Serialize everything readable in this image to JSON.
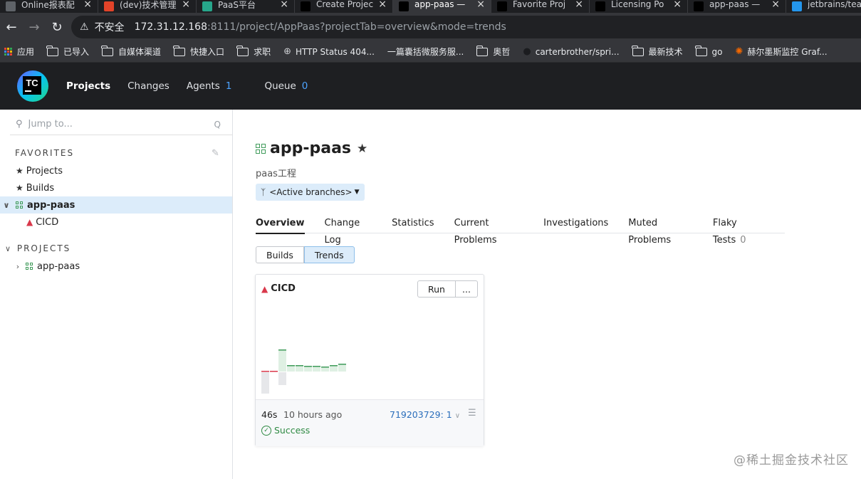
{
  "browser": {
    "tabs": [
      {
        "label": "Online报表配",
        "favicon": "globe-icon",
        "color": "#5f6368",
        "active": false
      },
      {
        "label": "(dev)技术管理",
        "favicon": "gitlab-icon",
        "color": "#e24329",
        "active": false
      },
      {
        "label": "PaaS平台",
        "favicon": "paas-icon",
        "color": "#27a68b",
        "active": false
      },
      {
        "label": "Create Projec",
        "favicon": "teamcity-icon",
        "color": "#000000",
        "active": false
      },
      {
        "label": "app-paas —",
        "favicon": "teamcity-icon",
        "color": "#000000",
        "active": true
      },
      {
        "label": "Favorite Proj",
        "favicon": "teamcity-icon",
        "color": "#000000",
        "active": false
      },
      {
        "label": "Licensing Po",
        "favicon": "jetbrains-icon",
        "color": "#000000",
        "active": false
      },
      {
        "label": "app-paas —",
        "favicon": "teamcity-icon",
        "color": "#000000",
        "active": false
      },
      {
        "label": "jetbrains/tea",
        "favicon": "docker-icon",
        "color": "#2496ed",
        "active": false
      }
    ],
    "insecure_label": "不安全",
    "url_host": "172.31.12.168",
    "url_rest": ":8111/project/AppPaas?projectTab=overview&mode=trends",
    "bookmarks": [
      {
        "label": "应用",
        "icon": "apps-grid-icon"
      },
      {
        "label": "已导入",
        "icon": "folder-icon"
      },
      {
        "label": "自媒体渠道",
        "icon": "folder-icon"
      },
      {
        "label": "快捷入口",
        "icon": "folder-icon"
      },
      {
        "label": "求职",
        "icon": "folder-icon"
      },
      {
        "label": "HTTP Status 404...",
        "icon": "globe-icon"
      },
      {
        "label": "一篇囊括微服务服...",
        "icon": "none"
      },
      {
        "label": "奥哲",
        "icon": "folder-icon"
      },
      {
        "label": "carterbrother/spri...",
        "icon": "github-icon"
      },
      {
        "label": "最新技术",
        "icon": "folder-icon"
      },
      {
        "label": "go",
        "icon": "folder-icon"
      },
      {
        "label": "赫尔墨斯监控 Graf...",
        "icon": "grafana-icon"
      }
    ]
  },
  "header": {
    "logo_text": "TC",
    "nav": {
      "projects": "Projects",
      "changes": "Changes",
      "agents": "Agents",
      "agents_count": "1",
      "queue": "Queue",
      "queue_count": "0"
    }
  },
  "sidebar": {
    "search_placeholder": "Jump to...",
    "search_shortcut": "Q",
    "favorites_title": "FAVORITES",
    "favorites": [
      {
        "label": "Projects"
      },
      {
        "label": "Builds"
      }
    ],
    "fav_project": "app-paas",
    "fav_build": "CICD",
    "projects_title": "PROJECTS",
    "project": "app-paas"
  },
  "main": {
    "title": "app-paas",
    "description": "paas工程",
    "branch_filter": "<Active branches>",
    "tabs": [
      {
        "label": "Overview",
        "selected": true
      },
      {
        "label": "Change Log"
      },
      {
        "label": "Statistics"
      },
      {
        "label": "Current Problems"
      },
      {
        "label": "Investigations"
      },
      {
        "label": "Muted Problems"
      },
      {
        "label": "Flaky Tests",
        "count": "0"
      }
    ],
    "mode_builds": "Builds",
    "mode_trends": "Trends",
    "card": {
      "title": "CICD",
      "run": "Run",
      "more": "...",
      "duration": "46s",
      "time_ago": "10 hours ago",
      "build_number": "719203729: 1",
      "status": "Success"
    }
  },
  "chart_data": {
    "type": "bar",
    "bars": [
      {
        "up": 0,
        "down": 0,
        "status": "failed"
      },
      {
        "up": 0,
        "down": 0,
        "status": "failed"
      },
      {
        "up": 30,
        "down": 18,
        "status": "success"
      },
      {
        "up": 8,
        "down": 0,
        "status": "success"
      },
      {
        "up": 8,
        "down": 0,
        "status": "success"
      },
      {
        "up": 7,
        "down": 0,
        "status": "success"
      },
      {
        "up": 7,
        "down": 0,
        "status": "success"
      },
      {
        "up": 6,
        "down": 0,
        "status": "success"
      },
      {
        "up": 8,
        "down": 0,
        "status": "success"
      },
      {
        "up": 10,
        "down": 0,
        "status": "success"
      }
    ],
    "first_bar_down": 30
  },
  "watermark": "@稀土掘金技术社区"
}
